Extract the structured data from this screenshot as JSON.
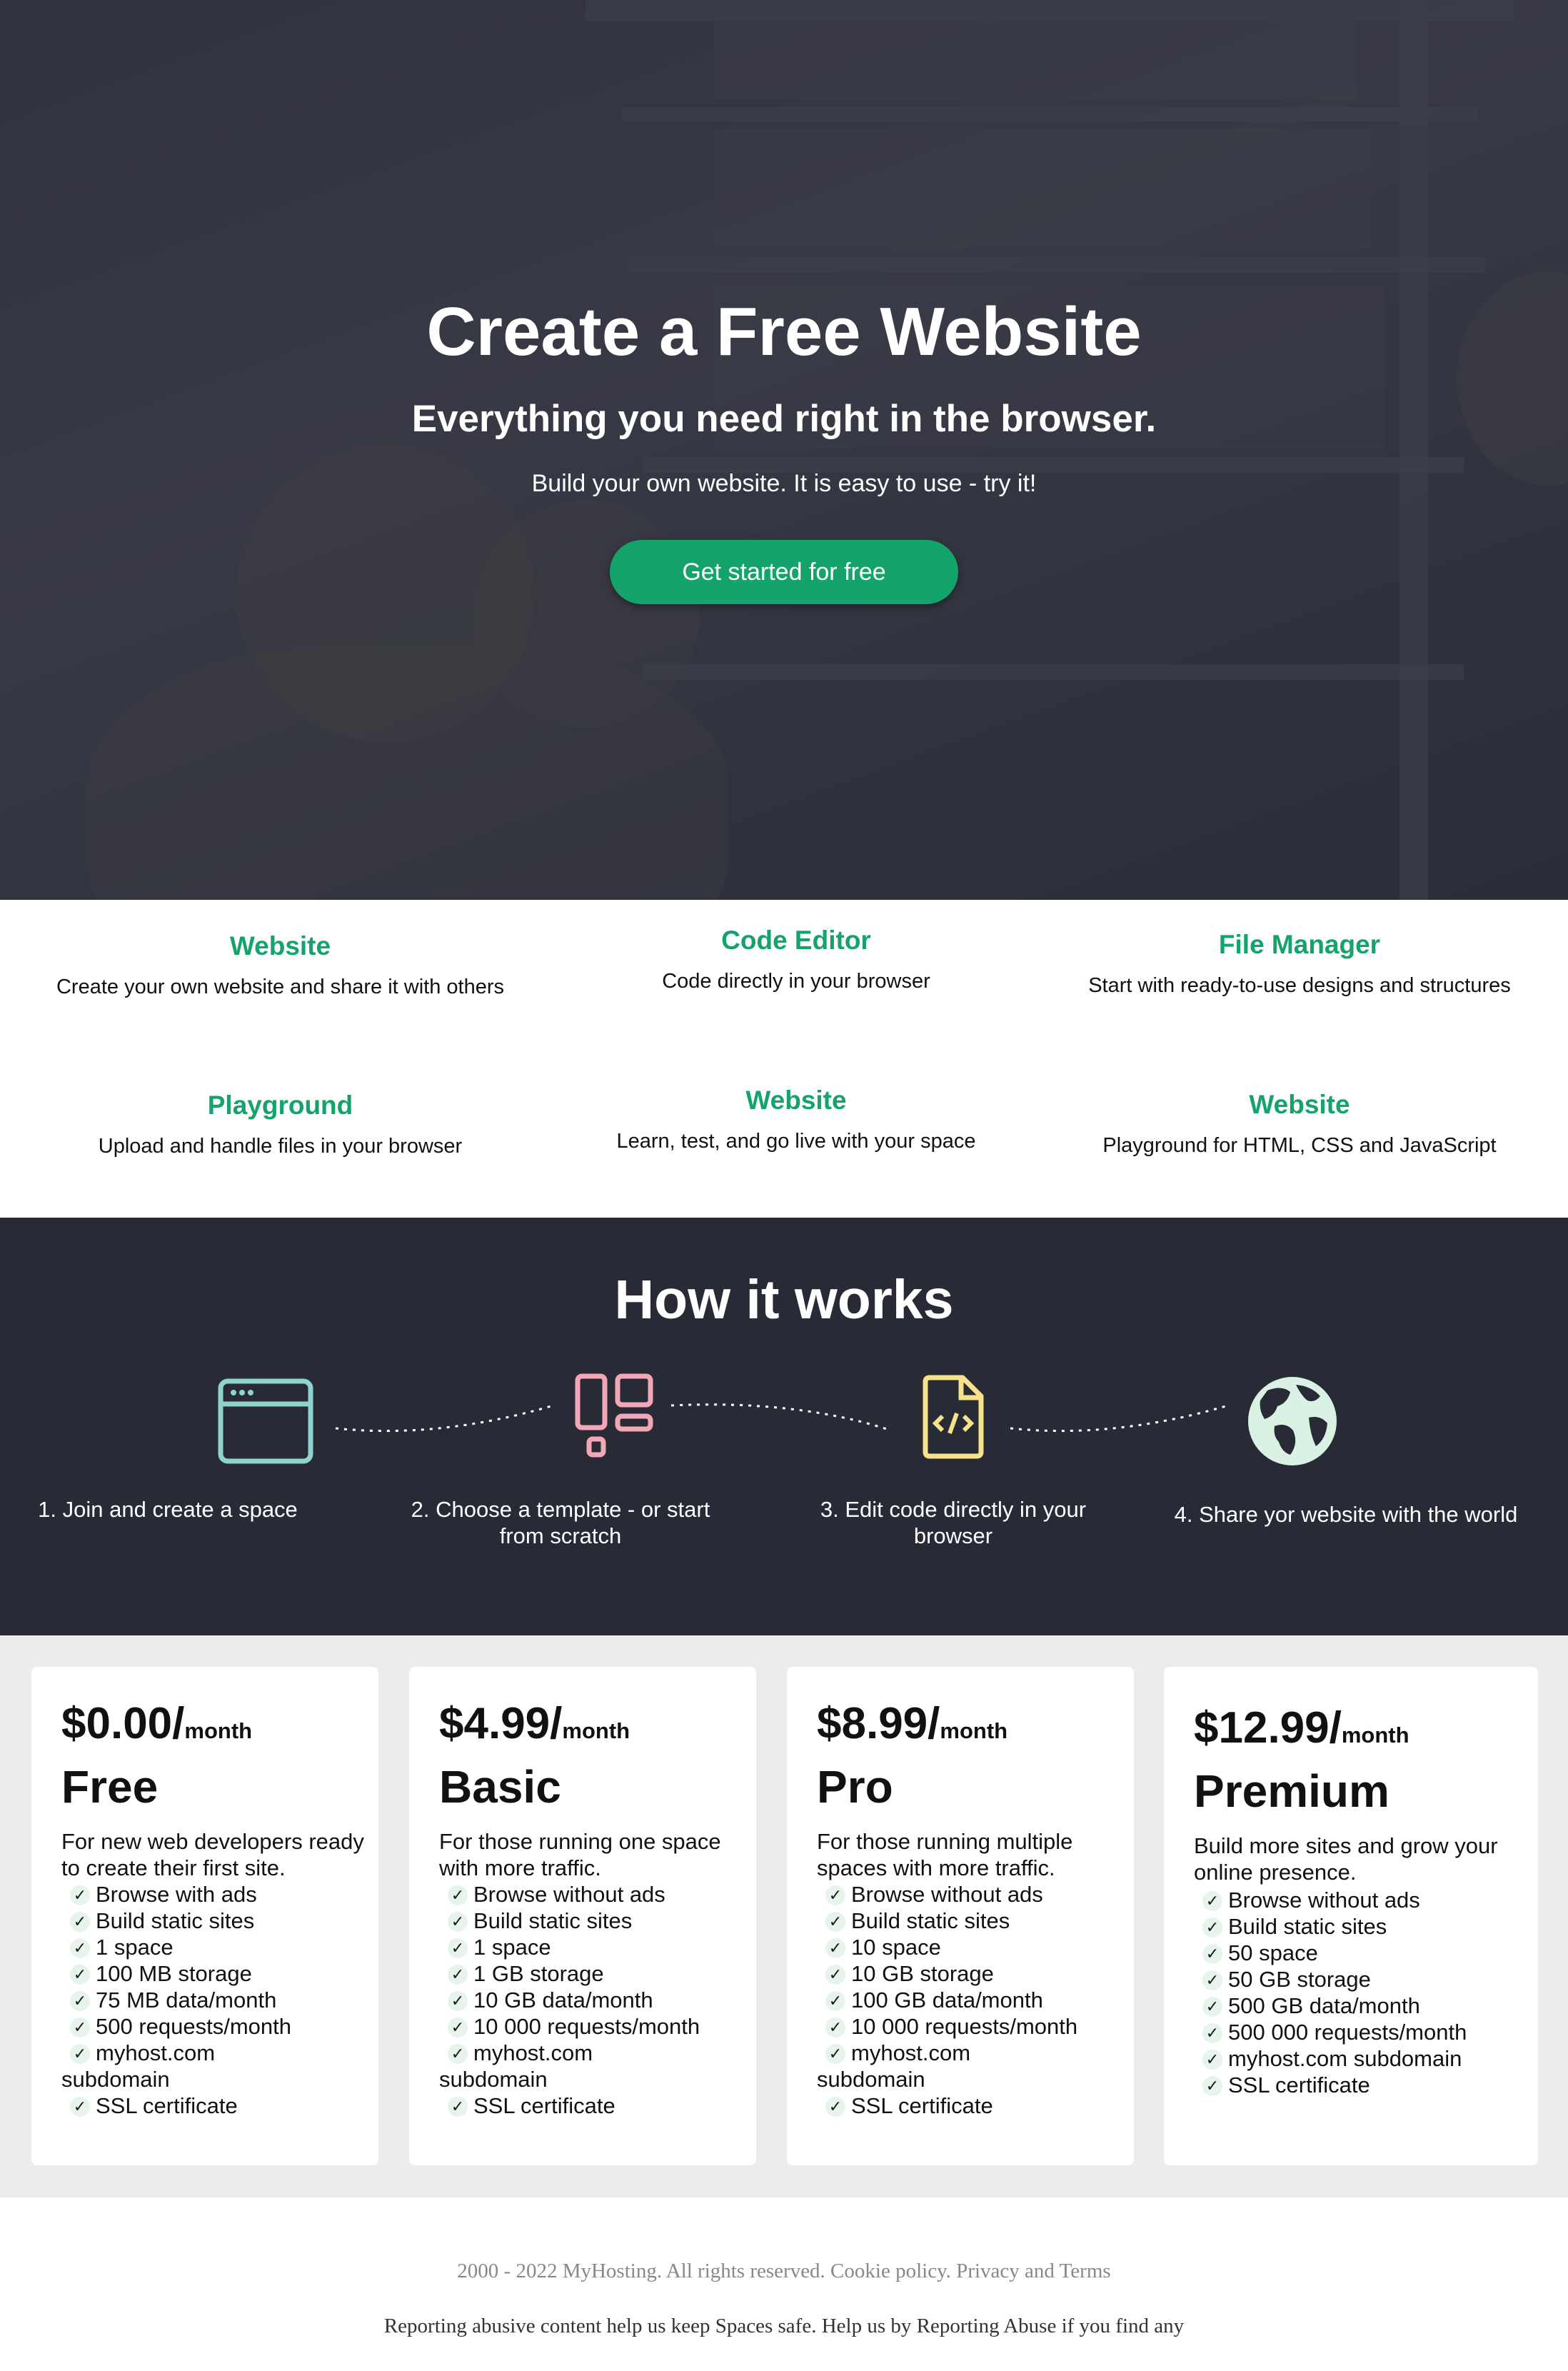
{
  "hero": {
    "title": "Create a Free Website",
    "subtitle": "Everything you need right in the browser.",
    "text": "Build your own website. It is easy to use - try it!",
    "cta_label": "Get started for free"
  },
  "features": [
    {
      "title": "Website",
      "desc": "Create your own website and share it with others"
    },
    {
      "title": "Code Editor",
      "desc": "Code directly in your browser"
    },
    {
      "title": "File Manager",
      "desc": "Start with ready-to-use designs and structures"
    },
    {
      "title": "Playground",
      "desc": "Upload and handle files in your browser"
    },
    {
      "title": "Website",
      "desc": "Learn, test, and go live with your space"
    },
    {
      "title": "Website",
      "desc": "Playground for HTML, CSS and JavaScript"
    }
  ],
  "how": {
    "title": "How it works",
    "steps": [
      {
        "label": "1. Join and create a space",
        "icon": "browser-window-icon",
        "color": "#8fd3cf"
      },
      {
        "label": "2. Choose a template - or start from scratch",
        "icon": "template-layout-icon",
        "color": "#f2a7b7"
      },
      {
        "label": "3. Edit code directly in your browser",
        "icon": "code-file-icon",
        "color": "#f5e28a"
      },
      {
        "label": "4. Share yor website with the world",
        "icon": "globe-icon",
        "color": "#d9f2e4"
      }
    ]
  },
  "pricing": {
    "per_label": "month",
    "plans": [
      {
        "price": "$0.00/",
        "name": "Free",
        "desc": "For new web developers ready to create their first site.",
        "features": [
          "Browse with ads",
          "Build static sites",
          "1 space",
          "100 MB storage",
          "75 MB data/month",
          "500 requests/month",
          "myhost.com subdomain",
          "SSL certificate"
        ]
      },
      {
        "price": "$4.99/",
        "name": "Basic",
        "desc": "For those running one space with more traffic.",
        "features": [
          "Browse without ads",
          "Build static sites",
          "1 space",
          "1 GB storage",
          "10 GB data/month",
          "10 000 requests/month",
          "myhost.com subdomain",
          "SSL certificate"
        ]
      },
      {
        "price": "$8.99/",
        "name": "Pro",
        "desc": "For those running multiple spaces with more traffic.",
        "features": [
          "Browse without ads",
          "Build static sites",
          "10 space",
          "10 GB storage",
          "100 GB data/month",
          "10 000 requests/month",
          "myhost.com subdomain",
          "SSL certificate"
        ]
      },
      {
        "price": "$12.99/",
        "name": "Premium",
        "desc": "Build more sites and grow your online presence.",
        "features": [
          "Browse without ads",
          "Build static sites",
          "50 space",
          "50 GB storage",
          "500 GB data/month",
          "500 000 requests/month",
          "myhost.com subdomain",
          "SSL certificate"
        ]
      }
    ]
  },
  "footer": {
    "line1": "2000 - 2022 MyHosting. All rights reserved. Cookie policy. Privacy and Terms",
    "line2": "Reporting abusive content help us keep Spaces safe. Help us by Reporting Abuse if you find any"
  },
  "colors": {
    "accent": "#14a36a",
    "dark": "#282a36",
    "pricing_bg": "#ececec"
  }
}
